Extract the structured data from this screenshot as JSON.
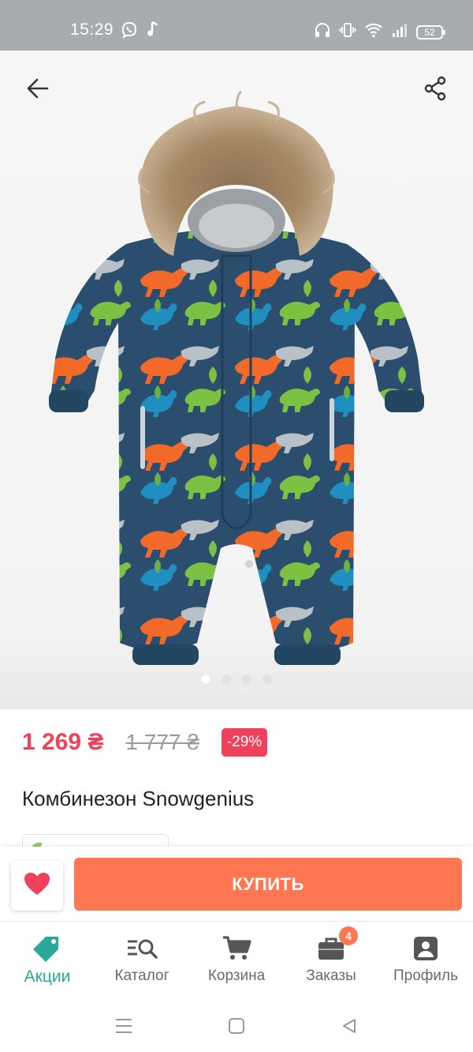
{
  "status_bar": {
    "time": "15:29",
    "battery": "52",
    "icons": [
      "viber-icon",
      "music-note-icon",
      "headphones-icon",
      "vibrate-icon",
      "wifi-icon",
      "signal-icon",
      "battery-icon"
    ]
  },
  "gallery": {
    "image_subject": "product-photo-snowsuit",
    "dots_count": 4,
    "active_index": 0
  },
  "price": {
    "current": "1 269 ₴",
    "old": "1 777 ₴",
    "discount": "-29%"
  },
  "product": {
    "title": "Комбинезон Snowgenius"
  },
  "actions": {
    "buy_label": "КУПИТЬ"
  },
  "bottom_nav": {
    "items": [
      {
        "label": "Акции",
        "icon": "tag-icon",
        "active": true
      },
      {
        "label": "Каталог",
        "icon": "catalog-search-icon",
        "active": false
      },
      {
        "label": "Корзина",
        "icon": "cart-icon",
        "active": false
      },
      {
        "label": "Заказы",
        "icon": "briefcase-icon",
        "active": false,
        "badge": "4"
      },
      {
        "label": "Профиль",
        "icon": "profile-icon",
        "active": false
      }
    ]
  },
  "colors": {
    "accent": "#f0405a",
    "buy_button": "#fe7752",
    "active_nav": "#2aa89a",
    "status_bar": "#a9acae"
  }
}
